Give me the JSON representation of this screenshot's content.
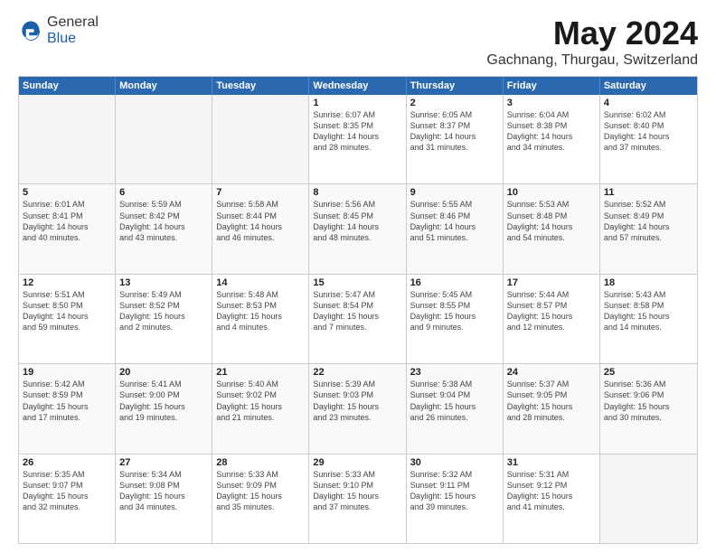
{
  "header": {
    "logo_general": "General",
    "logo_blue": "Blue",
    "month_title": "May 2024",
    "location": "Gachnang, Thurgau, Switzerland"
  },
  "weekdays": [
    "Sunday",
    "Monday",
    "Tuesday",
    "Wednesday",
    "Thursday",
    "Friday",
    "Saturday"
  ],
  "weeks": [
    [
      {
        "day": "",
        "info": "",
        "empty": true
      },
      {
        "day": "",
        "info": "",
        "empty": true
      },
      {
        "day": "",
        "info": "",
        "empty": true
      },
      {
        "day": "1",
        "info": "Sunrise: 6:07 AM\nSunset: 8:35 PM\nDaylight: 14 hours\nand 28 minutes.",
        "empty": false
      },
      {
        "day": "2",
        "info": "Sunrise: 6:05 AM\nSunset: 8:37 PM\nDaylight: 14 hours\nand 31 minutes.",
        "empty": false
      },
      {
        "day": "3",
        "info": "Sunrise: 6:04 AM\nSunset: 8:38 PM\nDaylight: 14 hours\nand 34 minutes.",
        "empty": false
      },
      {
        "day": "4",
        "info": "Sunrise: 6:02 AM\nSunset: 8:40 PM\nDaylight: 14 hours\nand 37 minutes.",
        "empty": false
      }
    ],
    [
      {
        "day": "5",
        "info": "Sunrise: 6:01 AM\nSunset: 8:41 PM\nDaylight: 14 hours\nand 40 minutes.",
        "empty": false
      },
      {
        "day": "6",
        "info": "Sunrise: 5:59 AM\nSunset: 8:42 PM\nDaylight: 14 hours\nand 43 minutes.",
        "empty": false
      },
      {
        "day": "7",
        "info": "Sunrise: 5:58 AM\nSunset: 8:44 PM\nDaylight: 14 hours\nand 46 minutes.",
        "empty": false
      },
      {
        "day": "8",
        "info": "Sunrise: 5:56 AM\nSunset: 8:45 PM\nDaylight: 14 hours\nand 48 minutes.",
        "empty": false
      },
      {
        "day": "9",
        "info": "Sunrise: 5:55 AM\nSunset: 8:46 PM\nDaylight: 14 hours\nand 51 minutes.",
        "empty": false
      },
      {
        "day": "10",
        "info": "Sunrise: 5:53 AM\nSunset: 8:48 PM\nDaylight: 14 hours\nand 54 minutes.",
        "empty": false
      },
      {
        "day": "11",
        "info": "Sunrise: 5:52 AM\nSunset: 8:49 PM\nDaylight: 14 hours\nand 57 minutes.",
        "empty": false
      }
    ],
    [
      {
        "day": "12",
        "info": "Sunrise: 5:51 AM\nSunset: 8:50 PM\nDaylight: 14 hours\nand 59 minutes.",
        "empty": false
      },
      {
        "day": "13",
        "info": "Sunrise: 5:49 AM\nSunset: 8:52 PM\nDaylight: 15 hours\nand 2 minutes.",
        "empty": false
      },
      {
        "day": "14",
        "info": "Sunrise: 5:48 AM\nSunset: 8:53 PM\nDaylight: 15 hours\nand 4 minutes.",
        "empty": false
      },
      {
        "day": "15",
        "info": "Sunrise: 5:47 AM\nSunset: 8:54 PM\nDaylight: 15 hours\nand 7 minutes.",
        "empty": false
      },
      {
        "day": "16",
        "info": "Sunrise: 5:45 AM\nSunset: 8:55 PM\nDaylight: 15 hours\nand 9 minutes.",
        "empty": false
      },
      {
        "day": "17",
        "info": "Sunrise: 5:44 AM\nSunset: 8:57 PM\nDaylight: 15 hours\nand 12 minutes.",
        "empty": false
      },
      {
        "day": "18",
        "info": "Sunrise: 5:43 AM\nSunset: 8:58 PM\nDaylight: 15 hours\nand 14 minutes.",
        "empty": false
      }
    ],
    [
      {
        "day": "19",
        "info": "Sunrise: 5:42 AM\nSunset: 8:59 PM\nDaylight: 15 hours\nand 17 minutes.",
        "empty": false
      },
      {
        "day": "20",
        "info": "Sunrise: 5:41 AM\nSunset: 9:00 PM\nDaylight: 15 hours\nand 19 minutes.",
        "empty": false
      },
      {
        "day": "21",
        "info": "Sunrise: 5:40 AM\nSunset: 9:02 PM\nDaylight: 15 hours\nand 21 minutes.",
        "empty": false
      },
      {
        "day": "22",
        "info": "Sunrise: 5:39 AM\nSunset: 9:03 PM\nDaylight: 15 hours\nand 23 minutes.",
        "empty": false
      },
      {
        "day": "23",
        "info": "Sunrise: 5:38 AM\nSunset: 9:04 PM\nDaylight: 15 hours\nand 26 minutes.",
        "empty": false
      },
      {
        "day": "24",
        "info": "Sunrise: 5:37 AM\nSunset: 9:05 PM\nDaylight: 15 hours\nand 28 minutes.",
        "empty": false
      },
      {
        "day": "25",
        "info": "Sunrise: 5:36 AM\nSunset: 9:06 PM\nDaylight: 15 hours\nand 30 minutes.",
        "empty": false
      }
    ],
    [
      {
        "day": "26",
        "info": "Sunrise: 5:35 AM\nSunset: 9:07 PM\nDaylight: 15 hours\nand 32 minutes.",
        "empty": false
      },
      {
        "day": "27",
        "info": "Sunrise: 5:34 AM\nSunset: 9:08 PM\nDaylight: 15 hours\nand 34 minutes.",
        "empty": false
      },
      {
        "day": "28",
        "info": "Sunrise: 5:33 AM\nSunset: 9:09 PM\nDaylight: 15 hours\nand 35 minutes.",
        "empty": false
      },
      {
        "day": "29",
        "info": "Sunrise: 5:33 AM\nSunset: 9:10 PM\nDaylight: 15 hours\nand 37 minutes.",
        "empty": false
      },
      {
        "day": "30",
        "info": "Sunrise: 5:32 AM\nSunset: 9:11 PM\nDaylight: 15 hours\nand 39 minutes.",
        "empty": false
      },
      {
        "day": "31",
        "info": "Sunrise: 5:31 AM\nSunset: 9:12 PM\nDaylight: 15 hours\nand 41 minutes.",
        "empty": false
      },
      {
        "day": "",
        "info": "",
        "empty": true
      }
    ]
  ]
}
